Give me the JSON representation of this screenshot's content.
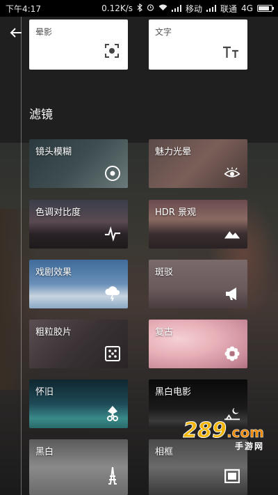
{
  "status": {
    "time": "下午4:17",
    "speed": "0.12K/s",
    "carrier1": "移动",
    "carrier2": "联通",
    "network": "4G"
  },
  "tools": [
    {
      "label": "晕影",
      "icon": "vignette-icon"
    },
    {
      "label": "文字",
      "icon": "text-icon"
    }
  ],
  "section_title": "滤镜",
  "filters": [
    {
      "label": "镜头模糊",
      "icon": "lens-blur-icon"
    },
    {
      "label": "魅力光晕",
      "icon": "eye-icon"
    },
    {
      "label": "色调对比度",
      "icon": "pulse-icon"
    },
    {
      "label": "HDR 景观",
      "icon": "mountains-icon"
    },
    {
      "label": "戏剧效果",
      "icon": "cloud-lightning-icon"
    },
    {
      "label": "斑驳",
      "icon": "megaphone-icon"
    },
    {
      "label": "粗粒胶片",
      "icon": "dice-icon"
    },
    {
      "label": "复古",
      "icon": "flower-gear-icon"
    },
    {
      "label": "怀旧",
      "icon": "pin-icon"
    },
    {
      "label": "黑白电影",
      "icon": "moon-landscape-icon"
    },
    {
      "label": "黑白",
      "icon": "tower-icon"
    },
    {
      "label": "相框",
      "icon": "frame-icon"
    }
  ],
  "watermark": {
    "number": "289",
    "suffix": ".com",
    "subtitle": "手游网"
  }
}
